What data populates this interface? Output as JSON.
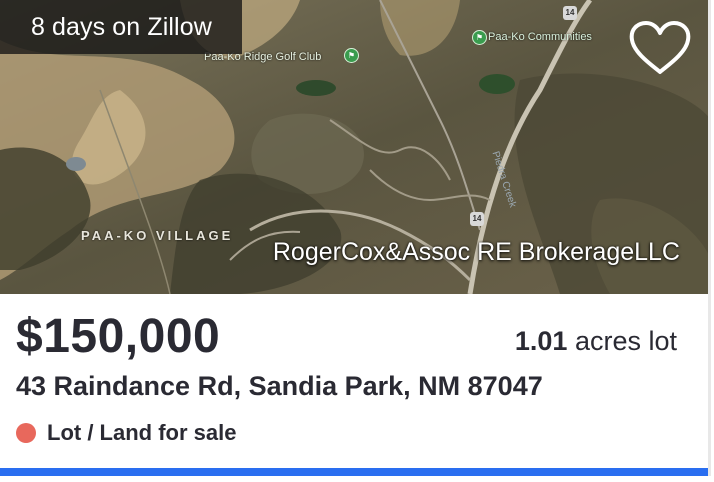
{
  "listing": {
    "days_badge": "8 days on Zillow",
    "brokerage": "RogerCox&Assoc RE BrokerageLLC",
    "price": "$150,000",
    "lot_size_value": "1.01",
    "lot_size_unit": "acres lot",
    "address": "43 Raindance Rd, Sandia Park, NM 87047",
    "status_text": "Lot / Land for sale",
    "status_color": "#e8685c",
    "accent_color": "#2a6ef0"
  },
  "map": {
    "village_label": "PAA-KO VILLAGE",
    "golf_label": "Paa-Ko Ridge Golf Club",
    "communities_label": "Paa-Ko Communities",
    "creek_label": "Piedra Creek",
    "highway_number": "14",
    "poi_icon": "golf-flag-icon"
  },
  "icons": {
    "favorite": "heart-outline-icon",
    "status": "status-dot-icon"
  }
}
